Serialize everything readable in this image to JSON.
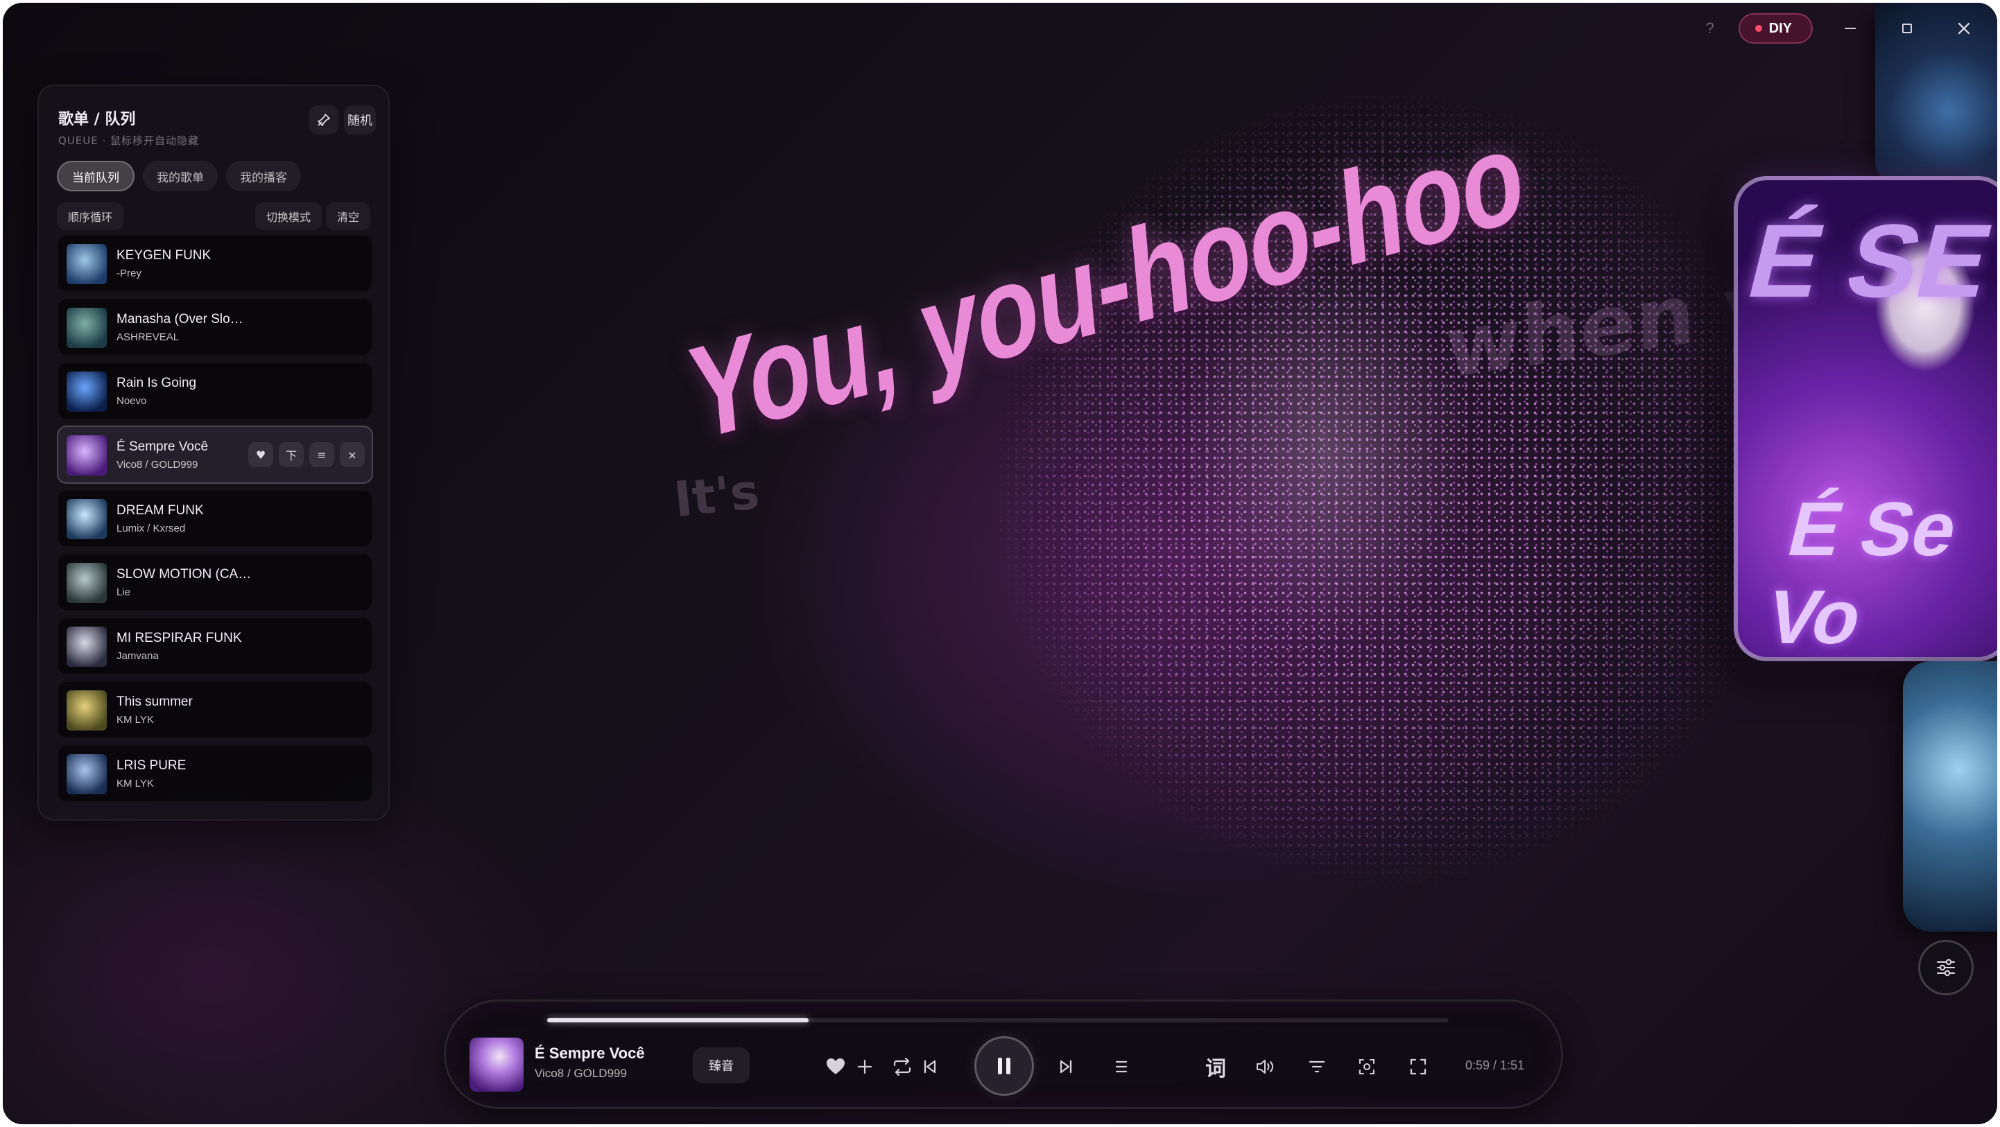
{
  "app": {
    "diy_label": "DIY",
    "help_label": "?"
  },
  "lyrics": {
    "current": "You, you-hoo-hoo",
    "next_fragment": "when y",
    "prev_fragment": "It's"
  },
  "album_art": {
    "title_text": "É SE",
    "sub_text": "É Se Vo"
  },
  "queue": {
    "title": "歌单 / 队列",
    "subtitle": "QUEUE · 鼠标移开自动隐藏",
    "shuffle_label": "随机",
    "tabs": [
      {
        "label": "当前队列",
        "active": true
      },
      {
        "label": "我的歌单",
        "active": false
      },
      {
        "label": "我的播客",
        "active": false
      }
    ],
    "mode_label": "顺序循环",
    "switch_mode_label": "切换模式",
    "clear_label": "清空",
    "items": [
      {
        "name": "KEYGEN FUNK",
        "artist": "-Prey",
        "current": false,
        "thumb": [
          "#9fc6e6",
          "#1d3c6a"
        ]
      },
      {
        "name": "Manasha (Over Slo…",
        "artist": "ASHREVEAL",
        "current": false,
        "thumb": [
          "#7fb0a4",
          "#1b3b46"
        ]
      },
      {
        "name": "Rain Is Going",
        "artist": "Noevo",
        "current": false,
        "thumb": [
          "#6aa6ff",
          "#0b1f4a"
        ]
      },
      {
        "name": "É Sempre Você",
        "artist": "Vico8 / GOLD999",
        "current": true,
        "thumb": [
          "#d9b6ff",
          "#4b1c7a"
        ]
      },
      {
        "name": "DREAM FUNK",
        "artist": "Lumix / Kxrsed",
        "current": false,
        "thumb": [
          "#c6e8ff",
          "#1c3a5c"
        ]
      },
      {
        "name": "SLOW MOTION (CA…",
        "artist": "Lie",
        "current": false,
        "thumb": [
          "#b8c8c8",
          "#2a3638"
        ]
      },
      {
        "name": "MI RESPIRAR FUNK",
        "artist": "Jamvana",
        "current": false,
        "thumb": [
          "#d8d8e6",
          "#2c2c40"
        ]
      },
      {
        "name": "This summer",
        "artist": "KM LYK",
        "current": false,
        "thumb": [
          "#e6d07a",
          "#4c4a1e"
        ]
      },
      {
        "name": "LRIS PURE",
        "artist": "KM LYK",
        "current": false,
        "thumb": [
          "#a8c4ee",
          "#1a2d52"
        ]
      }
    ],
    "current_actions": [
      {
        "name": "like",
        "glyph": "♥"
      },
      {
        "name": "next",
        "glyph": "下"
      },
      {
        "name": "add-to-playlist",
        "glyph": "≡"
      },
      {
        "name": "remove",
        "glyph": "×"
      }
    ]
  },
  "player": {
    "title": "É Sempre Você",
    "artist": "Vico8 / GOLD999",
    "quality_label": "臻音",
    "time": "0:59 / 1:51",
    "progress": 0.29,
    "lyrics_button": "词",
    "accent": "#e88ad6"
  }
}
